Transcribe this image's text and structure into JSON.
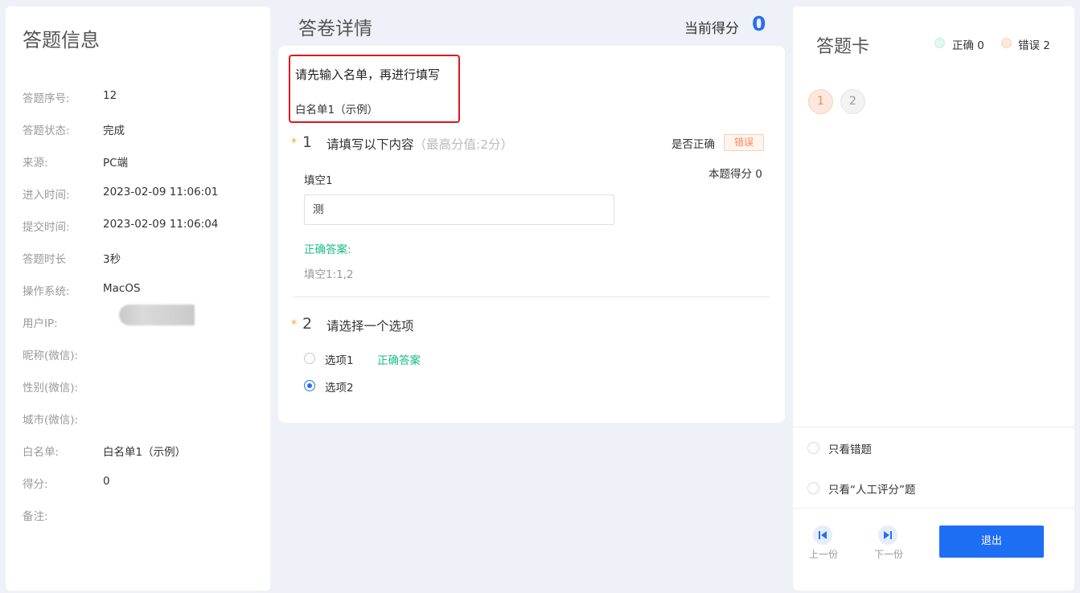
{
  "left": {
    "title": "答题信息",
    "rows": [
      {
        "label": "答题序号:",
        "value": "12"
      },
      {
        "label": "答题状态:",
        "value": "完成"
      },
      {
        "label": "来源:",
        "value": "PC端"
      },
      {
        "label": "进入时间:",
        "value": "2023-02-09 11:06:01"
      },
      {
        "label": "提交时间:",
        "value": "2023-02-09 11:06:04"
      },
      {
        "label": "答题时长",
        "value": "3秒"
      },
      {
        "label": "操作系统:",
        "value": "MacOS"
      },
      {
        "label": "用户IP:",
        "value": ""
      },
      {
        "label": "昵称(微信):",
        "value": ""
      },
      {
        "label": "性别(微信):",
        "value": ""
      },
      {
        "label": "城市(微信):",
        "value": ""
      },
      {
        "label": "白名单:",
        "value": "白名单1（示例）"
      },
      {
        "label": "得分:",
        "value": "0"
      },
      {
        "label": "备注:",
        "value": ""
      }
    ]
  },
  "middle": {
    "title": "答卷详情",
    "score_label": "当前得分",
    "score_value": "0",
    "notice_title": "请先输入名单，再进行填写",
    "notice_sub": "白名单1（示例）",
    "q1": {
      "star": "*",
      "num": "1",
      "title": "请填写以下内容",
      "hint": "（最高分值:2分）",
      "correct_label": "是否正确",
      "status_tag": "错误",
      "score_text": "本题得分 0",
      "fill_label": "填空1",
      "fill_value": "测",
      "answer_label": "正确答案:",
      "answer_value": "填空1:1,2"
    },
    "q2": {
      "star": "*",
      "num": "2",
      "title": "请选择一个选项",
      "options": [
        {
          "label": "选项1",
          "checked": false,
          "note": "正确答案"
        },
        {
          "label": "选项2",
          "checked": true,
          "note": ""
        }
      ]
    }
  },
  "right": {
    "title": "答题卡",
    "legend": [
      {
        "label": "正确 0",
        "color": "#e3f7ef"
      },
      {
        "label": "错误 2",
        "color": "#fde8dd"
      }
    ],
    "cards": [
      "1",
      "2"
    ],
    "filters": [
      "只看错题",
      "只看“人工评分”题"
    ],
    "prev_label": "上一份",
    "next_label": "下一份",
    "exit_label": "退出"
  },
  "colors": {
    "accent": "#1e6ef4",
    "correct": "#1abc84",
    "wrong": "#f38a5a",
    "highlight_border": "#e0141d"
  }
}
